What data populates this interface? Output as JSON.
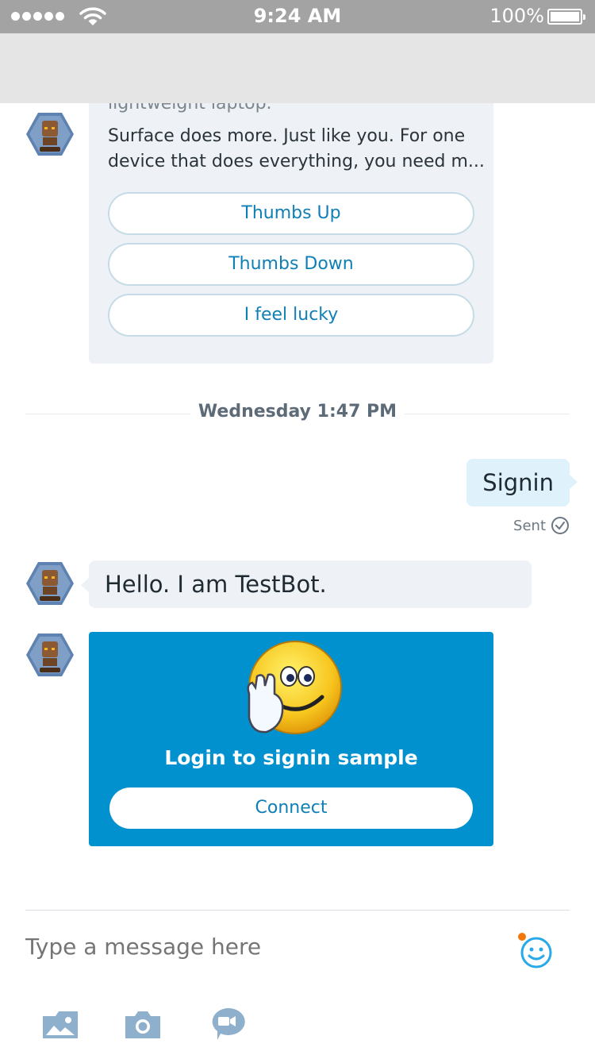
{
  "status_bar": {
    "time": "9:24 AM",
    "battery_percent": "100%",
    "signal_bars": 5
  },
  "messages": {
    "product_card": {
      "text_top": "lightweight laptop.",
      "body_line1": "Surface does more. Just like you. For one",
      "body_line2": "device that does everything, you need m...",
      "buttons": [
        "Thumbs Up",
        "Thumbs Down",
        "I feel lucky"
      ]
    },
    "date_divider": "Wednesday 1:47 PM",
    "outgoing": {
      "text": "Signin",
      "status": "Sent"
    },
    "incoming_text": "Hello. I am TestBot.",
    "signin_card": {
      "title": "Login to signin sample",
      "button_label": "Connect"
    }
  },
  "composer": {
    "placeholder": "Type a message here"
  },
  "icons": {
    "wifi": "wifi-icon",
    "battery": "battery-icon",
    "avatar": "bot-avatar-icon",
    "emoji": "emoticon-icon",
    "gallery": "image-gallery-icon",
    "camera": "camera-icon",
    "video": "video-message-icon"
  },
  "colors": {
    "accent": "#0191cf",
    "link": "#0f7fb5",
    "outgoing_bubble": "#dff1fb",
    "incoming_bubble": "#eef2f6",
    "icon": "#8fb0cc"
  }
}
